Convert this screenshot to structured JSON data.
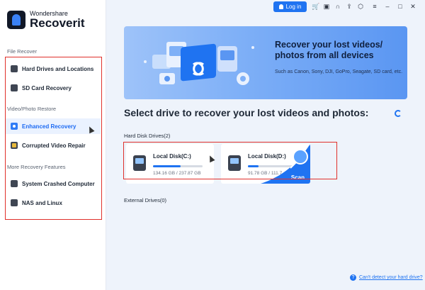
{
  "app": {
    "brand_small": "Wondershare",
    "brand_big": "Recoverit"
  },
  "sidebar": {
    "sections": [
      {
        "label": "File Recover"
      },
      {
        "label": "Video/Photo Restore"
      },
      {
        "label": "More Recovery Features"
      }
    ],
    "items": [
      {
        "label": "Hard Drives and Locations",
        "icon": "hard-drive-icon"
      },
      {
        "label": "SD Card Recovery",
        "icon": "sd-card-icon"
      },
      {
        "label": "Enhanced Recovery",
        "icon": "camera-icon",
        "active": true
      },
      {
        "label": "Corrupted Video Repair",
        "icon": "video-repair-icon"
      },
      {
        "label": "System Crashed Computer",
        "icon": "computer-icon"
      },
      {
        "label": "NAS and Linux",
        "icon": "nas-icon"
      }
    ]
  },
  "topbar": {
    "login_label": "Log in",
    "icons": [
      "cart-icon",
      "gift-icon",
      "headset-icon",
      "upload-icon",
      "settings-icon",
      "menu-icon",
      "minimize-icon",
      "maximize-icon",
      "close-icon"
    ]
  },
  "banner": {
    "title": "Recover your lost videos/ photos from all devices",
    "subtitle": "Such as Canon, Sony, DJI, GoPro, Seagate, SD card, etc."
  },
  "main": {
    "title": "Select drive to recover your lost videos and photos:",
    "hard_disk_label": "Hard Disk Drives(2)",
    "external_label": "External Drives(0)",
    "drives": [
      {
        "name": "Local Disk(C:)",
        "size": "134.16 GB / 237.87 GB",
        "used_fraction": 0.56
      },
      {
        "name": "Local Disk(D:)",
        "size": "91.78 GB / 111.7",
        "used_fraction": 0.22,
        "scan_label": "Scan"
      }
    ],
    "help_link": "Can't detect your hard drive?"
  },
  "colors": {
    "accent": "#1f73f1",
    "highlight_box": "#e0302b",
    "active_bg": "#eaf2ff"
  }
}
